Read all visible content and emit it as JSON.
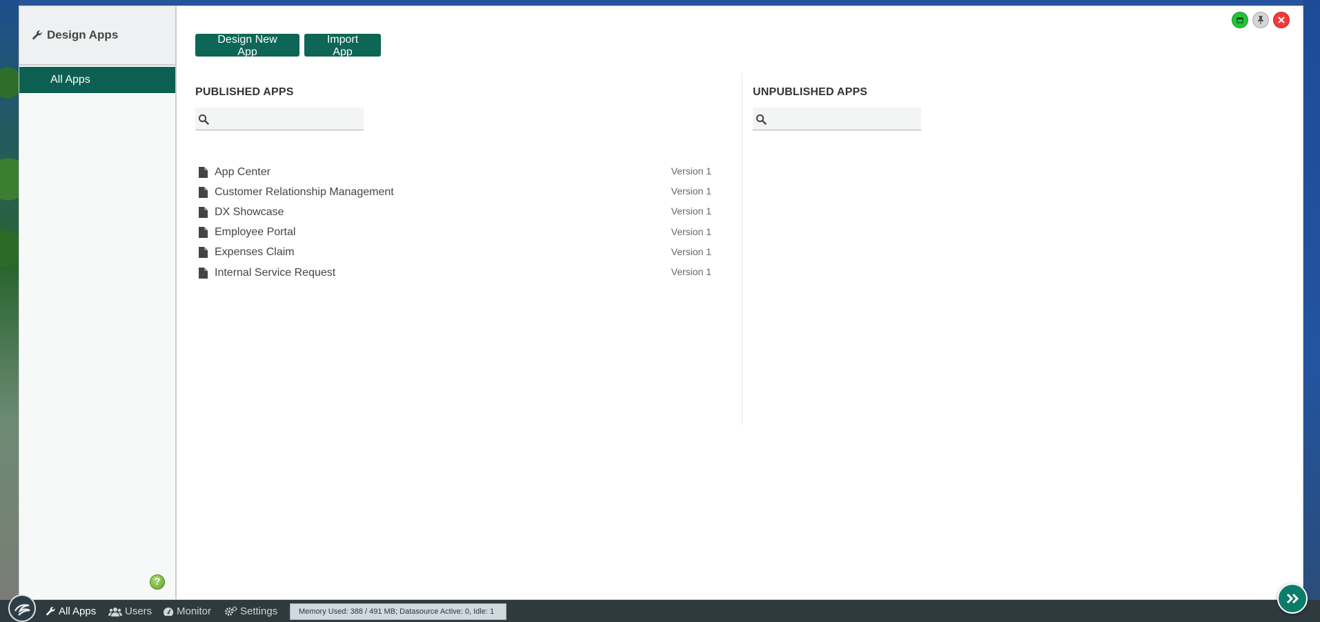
{
  "sidebar": {
    "title": "Design Apps",
    "items": [
      {
        "label": "All Apps",
        "active": true
      }
    ],
    "help_label": "?"
  },
  "toolbar": {
    "design_new_label": "Design New App",
    "import_label": "Import App"
  },
  "published": {
    "title": "PUBLISHED APPS",
    "search_placeholder": "",
    "apps": [
      {
        "name": "App Center",
        "version": "Version 1"
      },
      {
        "name": "Customer Relationship Management",
        "version": "Version 1"
      },
      {
        "name": "DX Showcase",
        "version": "Version 1"
      },
      {
        "name": "Employee Portal",
        "version": "Version 1"
      },
      {
        "name": "Expenses Claim",
        "version": "Version 1"
      },
      {
        "name": "Internal Service Request",
        "version": "Version 1"
      }
    ]
  },
  "unpublished": {
    "title": "UNPUBLISHED APPS",
    "search_placeholder": ""
  },
  "taskbar": {
    "items": [
      {
        "label": "All Apps",
        "icon": "wrench-icon",
        "active": true
      },
      {
        "label": "Users",
        "icon": "users-icon",
        "active": false
      },
      {
        "label": "Monitor",
        "icon": "dashboard-icon",
        "active": false
      },
      {
        "label": "Settings",
        "icon": "gears-icon",
        "active": false
      }
    ],
    "status": "Memory Used: 388 / 491 MB; Datasource Active: 0, Idle: 1"
  },
  "colors": {
    "accent": "#0d6656",
    "sidebar_active": "#0d5f52",
    "taskbar": "#2f3a3f"
  }
}
